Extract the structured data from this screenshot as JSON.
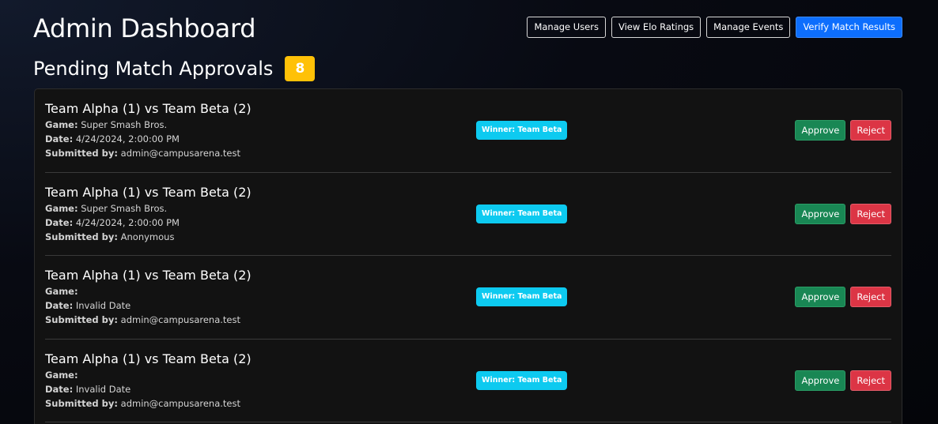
{
  "header": {
    "title": "Admin Dashboard",
    "nav": [
      {
        "label": "Manage Users"
      },
      {
        "label": "View Elo Ratings"
      },
      {
        "label": "Manage Events"
      },
      {
        "label": "Verify Match Results"
      }
    ]
  },
  "pending": {
    "title": "Pending Match Approvals",
    "count": "8",
    "labels": {
      "game": "Game:",
      "date": "Date:",
      "submitted_by": "Submitted by:",
      "approve": "Approve",
      "reject": "Reject"
    },
    "matches": [
      {
        "title": "Team Alpha (1) vs Team Beta (2)",
        "game": "Super Smash Bros.",
        "date": "4/24/2024, 2:00:00 PM",
        "submitted_by": "admin@campusarena.test",
        "winner": "Winner: Team Beta"
      },
      {
        "title": "Team Alpha (1) vs Team Beta (2)",
        "game": "Super Smash Bros.",
        "date": "4/24/2024, 2:00:00 PM",
        "submitted_by": "Anonymous",
        "winner": "Winner: Team Beta"
      },
      {
        "title": "Team Alpha (1) vs Team Beta (2)",
        "game": "",
        "date": "Invalid Date",
        "submitted_by": "admin@campusarena.test",
        "winner": "Winner: Team Beta"
      },
      {
        "title": "Team Alpha (1) vs Team Beta (2)",
        "game": "",
        "date": "Invalid Date",
        "submitted_by": "admin@campusarena.test",
        "winner": "Winner: Team Beta"
      }
    ]
  },
  "colors": {
    "primary": "#0d6efd",
    "warning": "#ffc107",
    "info": "#0dcaf0",
    "success": "#198754",
    "danger": "#dc3545"
  }
}
